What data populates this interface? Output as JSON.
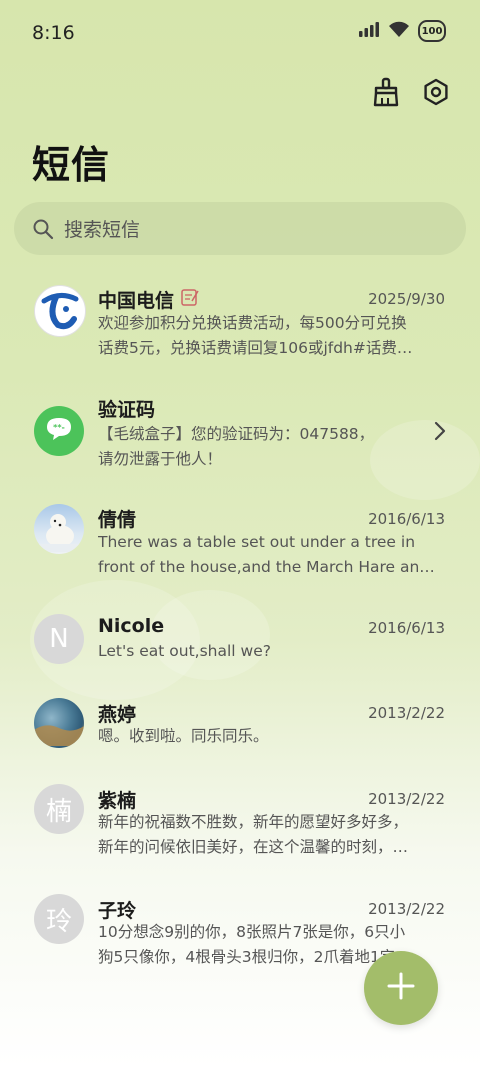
{
  "status_bar": {
    "time": "8:16",
    "battery": "100"
  },
  "header": {
    "title": "短信"
  },
  "search": {
    "placeholder": "搜索短信"
  },
  "conversations": [
    {
      "name": "中国电信",
      "date": "2025/9/30",
      "preview": [
        "欢迎参加积分兑换话费活动，每500分可兑换",
        "话费5元，兑换话费请回复106或jfdh#话费…"
      ]
    },
    {
      "name": "验证码",
      "date": "",
      "preview": [
        "【毛绒盒子】您的验证码为：047588，",
        "请勿泄露于他人！"
      ]
    },
    {
      "name": "倩倩",
      "date": "2016/6/13",
      "preview": [
        "There was a table set out under a tree in",
        "front of the house,and the March Hare an…"
      ]
    },
    {
      "name": "Nicole",
      "date": "2016/6/13",
      "avatar_letter": "N",
      "preview": [
        "Let's eat out,shall we?"
      ]
    },
    {
      "name": "燕婷",
      "date": "2013/2/22",
      "preview": [
        "嗯。收到啦。同乐同乐。"
      ]
    },
    {
      "name": "紫楠",
      "date": "2013/2/22",
      "avatar_letter": "楠",
      "preview": [
        "新年的祝福数不胜数，新年的愿望好多好多，",
        "新年的问候依旧美好，在这个温馨的时刻，…"
      ]
    },
    {
      "name": "子玲",
      "date": "2013/2/22",
      "avatar_letter": "玲",
      "preview": [
        "10分想念9别的你，8张照片7张是你，6只小",
        "狗5只像你，4根骨头3根归你，2爪着地1定…"
      ]
    }
  ],
  "colors": {
    "accent": "#a3bd6a",
    "telecom_blue": "#1e5cb3",
    "otp_green": "#4cc35a"
  }
}
